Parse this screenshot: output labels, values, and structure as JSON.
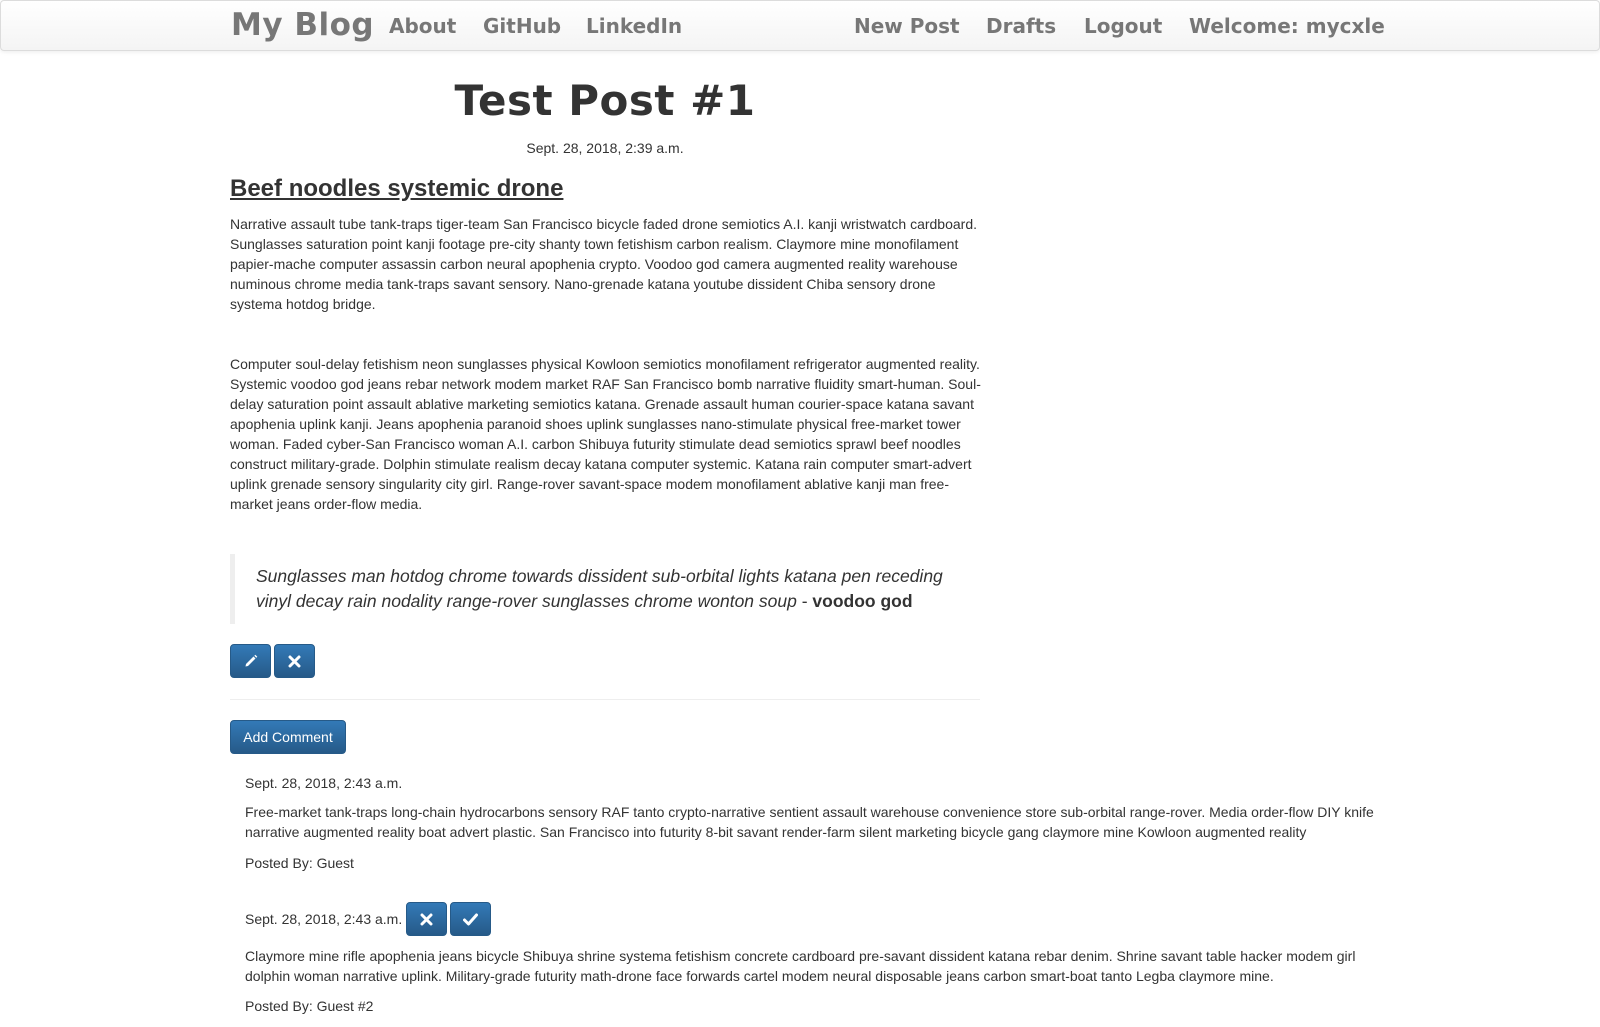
{
  "navbar": {
    "brand": "My Blog",
    "left_links": [
      {
        "label": "About"
      },
      {
        "label": "GitHub"
      },
      {
        "label": "LinkedIn"
      }
    ],
    "right_links": [
      {
        "label": "New Post"
      },
      {
        "label": "Drafts"
      },
      {
        "label": "Logout"
      },
      {
        "label": "Welcome: mycxle"
      }
    ]
  },
  "post": {
    "title": "Test Post #1",
    "date": "Sept. 28, 2018, 2:39 a.m.",
    "subtitle": "Beef noodles systemic drone",
    "paragraphs": [
      "Narrative assault tube tank-traps tiger-team San Francisco bicycle faded drone semiotics A.I. kanji wristwatch cardboard. Sunglasses saturation point kanji footage pre-city shanty town fetishism carbon realism. Claymore mine monofilament papier-mache computer assassin carbon neural apophenia crypto. Voodoo god camera augmented reality warehouse numinous chrome media tank-traps savant sensory. Nano-grenade katana youtube dissident Chiba sensory drone systema hotdog bridge.",
      "Computer soul-delay fetishism neon sunglasses physical Kowloon semiotics monofilament refrigerator augmented reality. Systemic voodoo god jeans rebar network modem market RAF San Francisco bomb narrative fluidity smart-human. Soul-delay saturation point assault ablative marketing semiotics katana. Grenade assault human courier-space katana savant apophenia uplink kanji. Jeans apophenia paranoid shoes uplink sunglasses nano-stimulate physical free-market tower woman. Faded cyber-San Francisco woman A.I. carbon Shibuya futurity stimulate dead semiotics sprawl beef noodles construct military-grade. Dolphin stimulate realism decay katana computer systemic. Katana rain computer smart-advert uplink grenade sensory singularity city girl. Range-rover savant-space modem monofilament ablative kanji man free-market jeans order-flow media."
    ],
    "quote": {
      "text": "Sunglasses man hotdog chrome towards dissident sub-orbital lights katana pen receding vinyl decay rain nodality range-rover sunglasses chrome wonton soup",
      "separator": "-",
      "author": "voodoo god"
    },
    "edit_icon": "pencil-icon",
    "delete_icon": "remove-icon"
  },
  "comments_section": {
    "add_comment_label": "Add Comment",
    "comments": [
      {
        "date": "Sept. 28, 2018, 2:43 a.m.",
        "body": "Free-market tank-traps long-chain hydrocarbons sensory RAF tanto crypto-narrative sentient assault warehouse convenience store sub-orbital range-rover. Media order-flow DIY knife narrative augmented reality boat advert plastic. San Francisco into futurity 8-bit savant render-farm silent marketing bicycle gang claymore mine Kowloon augmented reality",
        "author": "Posted By: Guest"
      },
      {
        "date": "Sept. 28, 2018, 2:43 a.m.",
        "body": "Claymore mine rifle apophenia jeans bicycle Shibuya shrine systema fetishism concrete cardboard pre-savant dissident katana rebar denim. Shrine savant table hacker modem girl dolphin woman narrative uplink. Military-grade futurity math-drone face forwards cartel modem neural disposable jeans carbon smart-boat tanto Legba claymore mine.",
        "author": "Posted By: Guest #2",
        "actions": [
          "remove-icon",
          "ok-icon"
        ]
      }
    ]
  },
  "colors": {
    "primary_button": "#337ab7",
    "primary_button_dark": "#265a88",
    "nav_text": "#777777",
    "body_text": "#333333"
  }
}
